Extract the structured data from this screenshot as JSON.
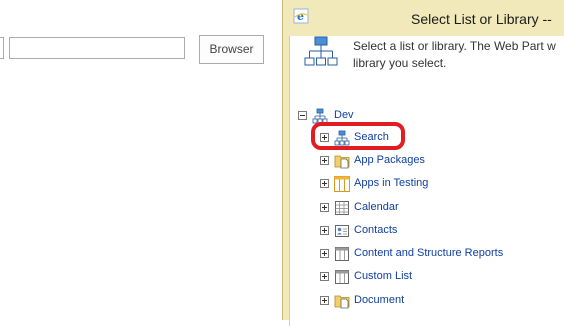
{
  "page": {
    "browse_button_label": "Browser"
  },
  "dialog": {
    "title": "Select List or Library --",
    "instruction_line1": "Select a list or library. The Web Part w",
    "instruction_line2": "library you select."
  },
  "tree": {
    "root": {
      "label": "Dev",
      "icon": "site-icon",
      "expanded": true
    },
    "items": [
      {
        "label": "Search",
        "icon": "site-icon",
        "highlighted": true
      },
      {
        "label": "App Packages",
        "icon": "library-icon"
      },
      {
        "label": "Apps in Testing",
        "icon": "list-grid-icon"
      },
      {
        "label": "Calendar",
        "icon": "calendar-icon"
      },
      {
        "label": "Contacts",
        "icon": "contacts-icon"
      },
      {
        "label": "Content and Structure Reports",
        "icon": "list-icon"
      },
      {
        "label": "Custom List",
        "icon": "list-icon"
      },
      {
        "label": "Document",
        "icon": "document-library-icon"
      }
    ]
  },
  "colors": {
    "dialog_frame": "#f1e9b9",
    "link_text": "#0f3f9f",
    "highlight": "#e11d22"
  }
}
